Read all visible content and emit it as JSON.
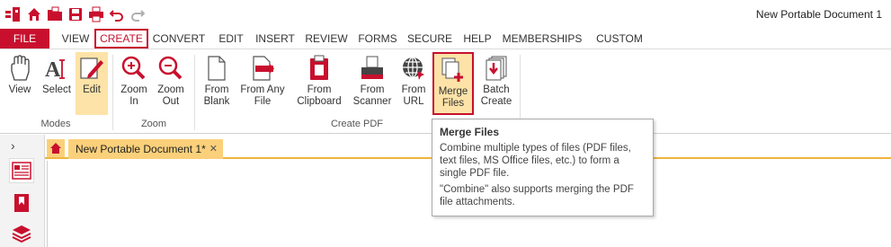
{
  "window": {
    "title": "New Portable Document 1"
  },
  "qat": {
    "items": [
      "app-logo-icon",
      "home-icon",
      "open-folder-icon",
      "save-icon",
      "print-icon",
      "undo-icon",
      "redo-icon"
    ]
  },
  "menu": {
    "tabs": [
      {
        "label": "FILE"
      },
      {
        "label": "VIEW"
      },
      {
        "label": "CREATE"
      },
      {
        "label": "CONVERT"
      },
      {
        "label": "EDIT"
      },
      {
        "label": "INSERT"
      },
      {
        "label": "REVIEW"
      },
      {
        "label": "FORMS"
      },
      {
        "label": "SECURE"
      },
      {
        "label": "HELP"
      },
      {
        "label": "MEMBERSHIPS"
      },
      {
        "label": "CUSTOM"
      }
    ],
    "active": "CREATE"
  },
  "ribbon": {
    "modes": {
      "label": "Modes",
      "view": {
        "l1": "View",
        "l2": ""
      },
      "select": {
        "l1": "Select",
        "l2": ""
      },
      "edit": {
        "l1": "Edit",
        "l2": ""
      }
    },
    "zoom": {
      "label": "Zoom",
      "zoom_in": {
        "l1": "Zoom",
        "l2": "In"
      },
      "zoom_out": {
        "l1": "Zoom",
        "l2": "Out"
      }
    },
    "create_pdf": {
      "label": "Create PDF",
      "from_blank": {
        "l1": "From",
        "l2": "Blank"
      },
      "from_any_file": {
        "l1": "From Any",
        "l2": "File"
      },
      "from_clipboard": {
        "l1": "From",
        "l2": "Clipboard"
      },
      "from_scanner": {
        "l1": "From",
        "l2": "Scanner"
      },
      "from_url": {
        "l1": "From",
        "l2": "URL"
      },
      "merge_files": {
        "l1": "Merge",
        "l2": "Files"
      },
      "batch_create": {
        "l1": "Batch",
        "l2": "Create"
      }
    }
  },
  "document_tabs": {
    "active_label": "New Portable Document 1*",
    "close_glyph": "✕",
    "expand_glyph": "›"
  },
  "tooltip": {
    "title": "Merge Files",
    "line1": "Combine multiple types of files (PDF files, text files, MS Office files, etc.) to form a single PDF file.",
    "line2": "\"Combine\" also supports merging the PDF file attachments."
  },
  "colors": {
    "accent": "#c8102e",
    "highlight": "#fde3a7",
    "tab_highlight": "#fbd07a"
  }
}
